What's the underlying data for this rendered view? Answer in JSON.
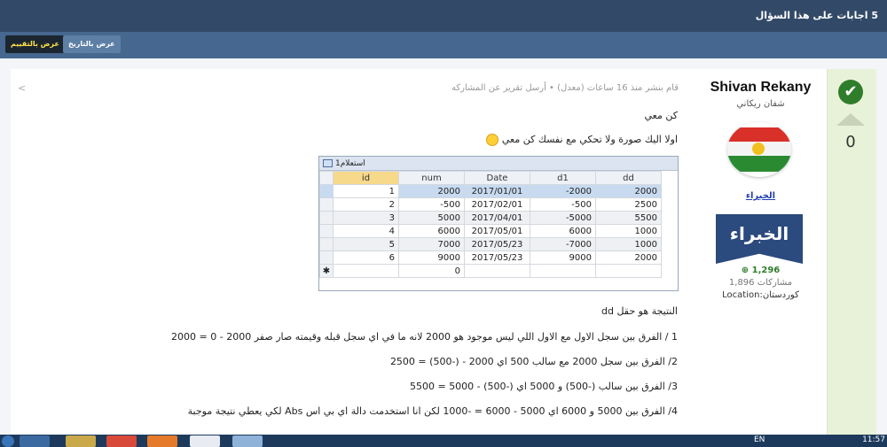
{
  "header": {
    "title": "5 اجابات على هذا السؤال"
  },
  "tabs": {
    "by_rating": "عرض بالتقييم",
    "by_date": "عرض بالتاريخ"
  },
  "vote": {
    "score": "0"
  },
  "user": {
    "name": "Shivan Rekany",
    "subname": "شفان ريكاني",
    "group_link": "الخبراء",
    "badge_text": "الخبراء",
    "reputation": "1,296",
    "posts": "1,896 مشاركات",
    "location": "Location:كوردستان"
  },
  "post": {
    "meta": "قام بنشر منذ 16 ساعات (معدل) • أرسل تقرير عن المشاركه",
    "line1": "كن معي",
    "line2": "اولا اليك صورة ولا تحكي مع نفسك كن معي",
    "result": "النتيجة هو حقل dd",
    "p1": "1 / الفرق بين سجل الاول مع الاول اللي ليس موجود هو 2000 لانه ما في اي سجل قبله وقيمته صار صفر 2000 - 0 = 2000",
    "p2": "2/ الفرق بين سجل 2000 مع سالب 500 اي 2000 - (-500) = 2500",
    "p3": "3/ الفرق بين سالب (-500) و 5000 اي (-500) - 5000 = 5500",
    "p4": "4/ الفرق بين 5000 و 6000 اي 5000 - 6000 = -1000 لكن انا استخدمت دالة اي بي اس Abs لكي يعطي نتيجة موجبة"
  },
  "access": {
    "title": "استعلام1",
    "columns": [
      "id",
      "num",
      "Date",
      "d1",
      "dd"
    ],
    "rows": [
      [
        "1",
        "2000",
        "2017/01/01",
        "-2000",
        "2000"
      ],
      [
        "2",
        "-500",
        "2017/02/01",
        "-500",
        "2500"
      ],
      [
        "3",
        "5000",
        "2017/04/01",
        "-5000",
        "5500"
      ],
      [
        "4",
        "6000",
        "2017/05/01",
        "6000",
        "1000"
      ],
      [
        "5",
        "7000",
        "2017/05/23",
        "-7000",
        "1000"
      ],
      [
        "6",
        "9000",
        "2017/05/23",
        "9000",
        "2000"
      ]
    ],
    "new_row_marker": "✱",
    "new_row_num": "0"
  },
  "taskbar": {
    "lang": "EN",
    "clock": "11:57"
  },
  "colors": {
    "header_bg": "#324a68",
    "toolbar_bg": "#46678f",
    "accent_green": "#2f7d2b"
  }
}
